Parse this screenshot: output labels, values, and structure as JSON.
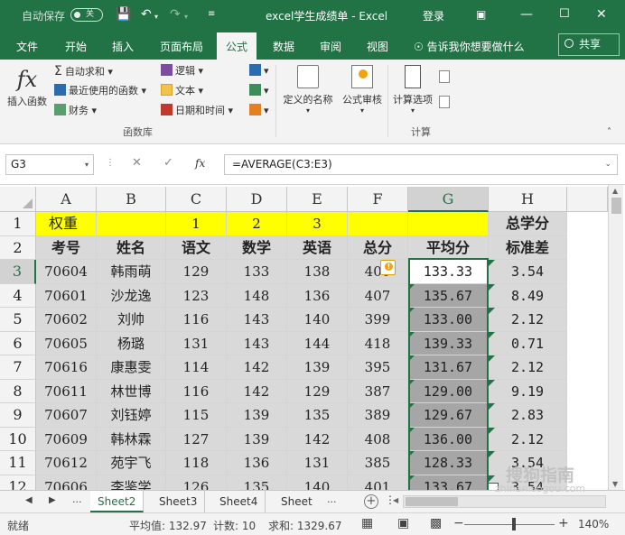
{
  "titlebar": {
    "autosave_label": "自动保存",
    "autosave_state": "关",
    "title": "excel学生成绩单  -  Excel",
    "signin": "登录"
  },
  "tabs": [
    "文件",
    "开始",
    "插入",
    "页面布局",
    "公式",
    "数据",
    "审阅",
    "视图"
  ],
  "active_tab": "公式",
  "tellme": "告诉我你想要做什么",
  "share": "共享",
  "ribbon": {
    "insert_function": "插入函数",
    "autosum": "自动求和",
    "recent": "最近使用的函数",
    "finance": "财务",
    "logical": "逻辑",
    "text": "文本",
    "datetime": "日期和时间",
    "group_library": "函数库",
    "defined_names": "定义的名称",
    "formula_audit": "公式审核",
    "calc_options": "计算选项",
    "group_calc": "计算"
  },
  "formula_bar": {
    "name_box": "G3",
    "formula": "=AVERAGE(C3:E3)",
    "fx": "fx"
  },
  "columns": [
    "A",
    "B",
    "C",
    "D",
    "E",
    "F",
    "G",
    "H"
  ],
  "row_numbers": [
    "1",
    "2",
    "3",
    "4",
    "5",
    "6",
    "7",
    "8",
    "9",
    "10",
    "11",
    "12"
  ],
  "row1": {
    "a": "权重",
    "c": "1",
    "d": "2",
    "e": "3",
    "h": "总学分"
  },
  "row2": {
    "a": "考号",
    "b": "姓名",
    "c": "语文",
    "d": "数学",
    "e": "英语",
    "f": "总分",
    "g": "平均分",
    "h": "标准差"
  },
  "rows": [
    [
      "70604",
      "韩雨萌",
      "129",
      "133",
      "138",
      "400",
      "133.33",
      "3.54"
    ],
    [
      "70601",
      "沙龙逸",
      "123",
      "148",
      "136",
      "407",
      "135.67",
      "8.49"
    ],
    [
      "70602",
      "刘帅",
      "116",
      "143",
      "140",
      "399",
      "133.00",
      "2.12"
    ],
    [
      "70605",
      "杨璐",
      "131",
      "143",
      "144",
      "418",
      "139.33",
      "0.71"
    ],
    [
      "70616",
      "康惠雯",
      "114",
      "142",
      "139",
      "395",
      "131.67",
      "2.12"
    ],
    [
      "70611",
      "林世博",
      "116",
      "142",
      "129",
      "387",
      "129.00",
      "9.19"
    ],
    [
      "70607",
      "刘钰婷",
      "115",
      "139",
      "135",
      "389",
      "129.67",
      "2.83"
    ],
    [
      "70609",
      "韩林霖",
      "127",
      "139",
      "142",
      "408",
      "136.00",
      "2.12"
    ],
    [
      "70612",
      "苑宇飞",
      "118",
      "136",
      "131",
      "385",
      "128.33",
      "3.54"
    ],
    [
      "70606",
      "李鉴学",
      "126",
      "135",
      "140",
      "401",
      "133.67",
      "3.54"
    ]
  ],
  "sheets": [
    "Sheet2",
    "Sheet3",
    "Sheet4",
    "Sheet"
  ],
  "active_sheet": "Sheet2",
  "status": {
    "ready": "就绪",
    "average": "平均值: 132.97",
    "count": "计数: 10",
    "sum": "求和: 1329.67",
    "zoom": "140%"
  },
  "watermark": "搜狗指南",
  "watermark_url": "zhinan.sogou.com",
  "colors": {
    "excel_green": "#217346",
    "highlight_yellow": "#ffff00",
    "header_gray": "#d9d9d9",
    "selection_gray": "#a6a6a6"
  }
}
